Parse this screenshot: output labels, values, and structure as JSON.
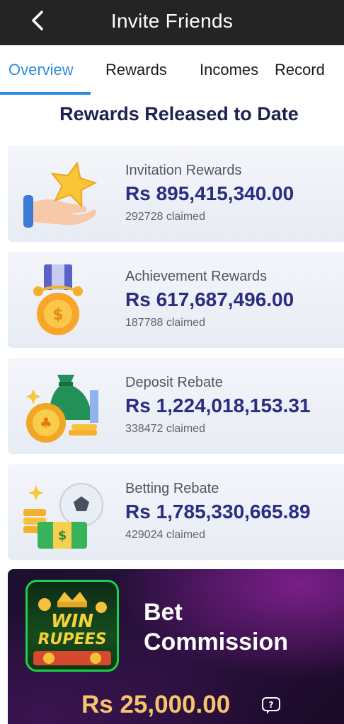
{
  "header": {
    "title": "Invite Friends",
    "back_icon": "chevron-left-icon"
  },
  "tabs": [
    {
      "label": "Overview",
      "active": true
    },
    {
      "label": "Rewards",
      "active": false
    },
    {
      "label": "Incomes",
      "active": false
    },
    {
      "label": "Record",
      "active": false
    }
  ],
  "section_title": "Rewards Released to Date",
  "cards": [
    {
      "label": "Invitation Rewards",
      "amount": "Rs  895,415,340.00",
      "claimed": "292728 claimed",
      "icon": "hand-star-icon"
    },
    {
      "label": "Achievement Rewards",
      "amount": "Rs  617,687,496.00",
      "claimed": "187788 claimed",
      "icon": "medal-icon"
    },
    {
      "label": "Deposit Rebate",
      "amount": "Rs  1,224,018,153.31",
      "claimed": "338472 claimed",
      "icon": "money-bag-icon"
    },
    {
      "label": "Betting Rebate",
      "amount": "Rs  1,785,330,665.89",
      "claimed": "429024 claimed",
      "icon": "football-cash-icon"
    }
  ],
  "banner": {
    "logo_text_1": "WIN",
    "logo_text_2": "RUPEES",
    "title_line1": "Bet",
    "title_line2": "Commission",
    "amount": "Rs 25,000.00",
    "help_icon": "help-chat-icon"
  },
  "colors": {
    "accent": "#2b8ce0",
    "amount": "#2a2d80",
    "topbar": "#242424",
    "banner_amount": "#f6c46c"
  }
}
